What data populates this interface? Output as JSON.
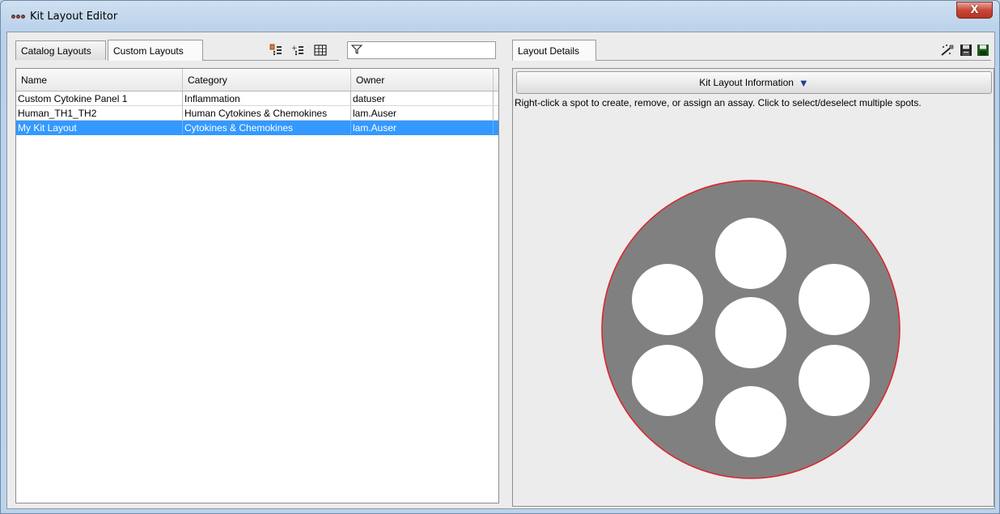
{
  "window": {
    "title": "Kit Layout Editor",
    "close_label": "X"
  },
  "left": {
    "tabs": [
      {
        "label": "Catalog Layouts",
        "active": false
      },
      {
        "label": "Custom Layouts",
        "active": true
      }
    ],
    "toolbar_icons": [
      "new-layout-icon",
      "copy-layout-icon",
      "table-view-icon"
    ],
    "filter": {
      "icon": "funnel-icon",
      "value": "",
      "placeholder": ""
    },
    "table": {
      "columns": [
        "Name",
        "Category",
        "Owner"
      ],
      "rows": [
        {
          "name": "Custom Cytokine Panel 1",
          "category": "Inflammation",
          "owner": "datuser",
          "selected": false
        },
        {
          "name": "Human_TH1_TH2",
          "category": "Human Cytokines & Chemokines",
          "owner": "lam.Auser",
          "selected": false
        },
        {
          "name": "My Kit Layout",
          "category": "Cytokines & Chemokines",
          "owner": "lam.Auser",
          "selected": true
        }
      ]
    }
  },
  "right": {
    "tab": "Layout Details",
    "toolbar_icons": [
      "assign-assay-icon",
      "save-as-icon",
      "save-icon"
    ],
    "info_button": {
      "label": "Kit Layout Information",
      "caret": "▼"
    },
    "hint": "Right-click a spot to create, remove, or assign an assay. Click to select/deselect multiple spots.",
    "plate": {
      "outline_color": "#e0202a",
      "fill_color": "#808080",
      "spot_color": "#ffffff",
      "spot_count": 7
    }
  }
}
